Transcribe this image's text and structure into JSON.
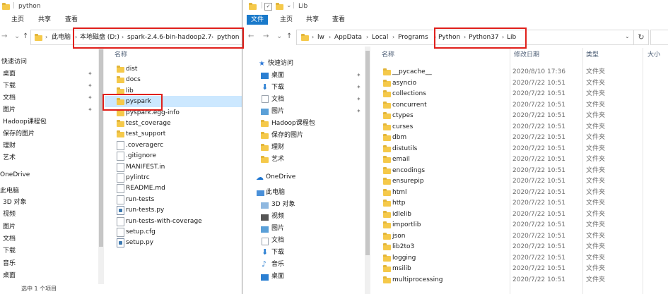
{
  "left_window": {
    "title": "python",
    "ribbon_tabs": [
      "主页",
      "共享",
      "查看"
    ],
    "breadcrumb": [
      "此电脑",
      "本地磁盘 (D:)",
      "spark-2.4.6-bin-hadoop2.7",
      "python"
    ],
    "nav_quick_access": "快速访问",
    "nav_items": [
      {
        "label": "桌面",
        "pinned": true
      },
      {
        "label": "下载",
        "pinned": true
      },
      {
        "label": "文档",
        "pinned": true
      },
      {
        "label": "图片",
        "pinned": true
      },
      {
        "label": "Hadoop课程包",
        "pinned": false
      },
      {
        "label": "保存的图片",
        "pinned": false
      },
      {
        "label": "理财",
        "pinned": false
      },
      {
        "label": "艺术",
        "pinned": false
      }
    ],
    "nav_onedrive": "OneDrive",
    "nav_this_pc": "此电脑",
    "nav_pc_items": [
      "3D 对象",
      "视频",
      "图片",
      "文档",
      "下载",
      "音乐",
      "桌面"
    ],
    "column_name": "名称",
    "files": [
      {
        "name": "dist",
        "type": "folder"
      },
      {
        "name": "docs",
        "type": "folder"
      },
      {
        "name": "lib",
        "type": "folder"
      },
      {
        "name": "pyspark",
        "type": "folder",
        "selected": true
      },
      {
        "name": "pyspark.egg-info",
        "type": "folder"
      },
      {
        "name": "test_coverage",
        "type": "folder"
      },
      {
        "name": "test_support",
        "type": "folder"
      },
      {
        "name": ".coveragerc",
        "type": "file"
      },
      {
        "name": ".gitignore",
        "type": "file"
      },
      {
        "name": "MANIFEST.in",
        "type": "file"
      },
      {
        "name": "pylintrc",
        "type": "file"
      },
      {
        "name": "README.md",
        "type": "file"
      },
      {
        "name": "run-tests",
        "type": "file"
      },
      {
        "name": "run-tests.py",
        "type": "py"
      },
      {
        "name": "run-tests-with-coverage",
        "type": "file"
      },
      {
        "name": "setup.cfg",
        "type": "file"
      },
      {
        "name": "setup.py",
        "type": "py"
      }
    ],
    "status": "选中 1 个项目"
  },
  "right_window": {
    "title": "Lib",
    "ribbon_tabs": [
      "文件",
      "主页",
      "共享",
      "查看"
    ],
    "breadcrumb": [
      "lw",
      "AppData",
      "Local",
      "Programs",
      "Python",
      "Python37",
      "Lib"
    ],
    "nav_quick_access": "快速访问",
    "nav_items": [
      {
        "label": "桌面",
        "pinned": true
      },
      {
        "label": "下载",
        "pinned": true
      },
      {
        "label": "文档",
        "pinned": true
      },
      {
        "label": "图片",
        "pinned": true
      },
      {
        "label": "Hadoop课程包",
        "pinned": false
      },
      {
        "label": "保存的图片",
        "pinned": false
      },
      {
        "label": "理财",
        "pinned": false
      },
      {
        "label": "艺术",
        "pinned": false
      }
    ],
    "nav_onedrive": "OneDrive",
    "nav_this_pc": "此电脑",
    "nav_pc_items": [
      "3D 对象",
      "视频",
      "图片",
      "文档",
      "下载",
      "音乐",
      "桌面"
    ],
    "columns": {
      "name": "名称",
      "date": "修改日期",
      "type": "类型",
      "size": "大小"
    },
    "files": [
      {
        "name": "__pycache__",
        "date": "2020/8/10 17:36",
        "type": "文件夹"
      },
      {
        "name": "asyncio",
        "date": "2020/7/22 10:51",
        "type": "文件夹"
      },
      {
        "name": "collections",
        "date": "2020/7/22 10:51",
        "type": "文件夹"
      },
      {
        "name": "concurrent",
        "date": "2020/7/22 10:51",
        "type": "文件夹"
      },
      {
        "name": "ctypes",
        "date": "2020/7/22 10:51",
        "type": "文件夹"
      },
      {
        "name": "curses",
        "date": "2020/7/22 10:51",
        "type": "文件夹"
      },
      {
        "name": "dbm",
        "date": "2020/7/22 10:51",
        "type": "文件夹"
      },
      {
        "name": "distutils",
        "date": "2020/7/22 10:51",
        "type": "文件夹"
      },
      {
        "name": "email",
        "date": "2020/7/22 10:51",
        "type": "文件夹"
      },
      {
        "name": "encodings",
        "date": "2020/7/22 10:51",
        "type": "文件夹"
      },
      {
        "name": "ensurepip",
        "date": "2020/7/22 10:51",
        "type": "文件夹"
      },
      {
        "name": "html",
        "date": "2020/7/22 10:51",
        "type": "文件夹"
      },
      {
        "name": "http",
        "date": "2020/7/22 10:51",
        "type": "文件夹"
      },
      {
        "name": "idlelib",
        "date": "2020/7/22 10:51",
        "type": "文件夹"
      },
      {
        "name": "importlib",
        "date": "2020/7/22 10:51",
        "type": "文件夹"
      },
      {
        "name": "json",
        "date": "2020/7/22 10:51",
        "type": "文件夹"
      },
      {
        "name": "lib2to3",
        "date": "2020/7/22 10:51",
        "type": "文件夹"
      },
      {
        "name": "logging",
        "date": "2020/7/22 10:51",
        "type": "文件夹"
      },
      {
        "name": "msilib",
        "date": "2020/7/22 10:51",
        "type": "文件夹"
      },
      {
        "name": "multiprocessing",
        "date": "2020/7/22 10:51",
        "type": "文件夹"
      }
    ]
  },
  "colors": {
    "highlight_box": "#e0201b",
    "selection": "#cce8ff",
    "file_tab": "#1979ca",
    "folder": "#f5c94a"
  }
}
